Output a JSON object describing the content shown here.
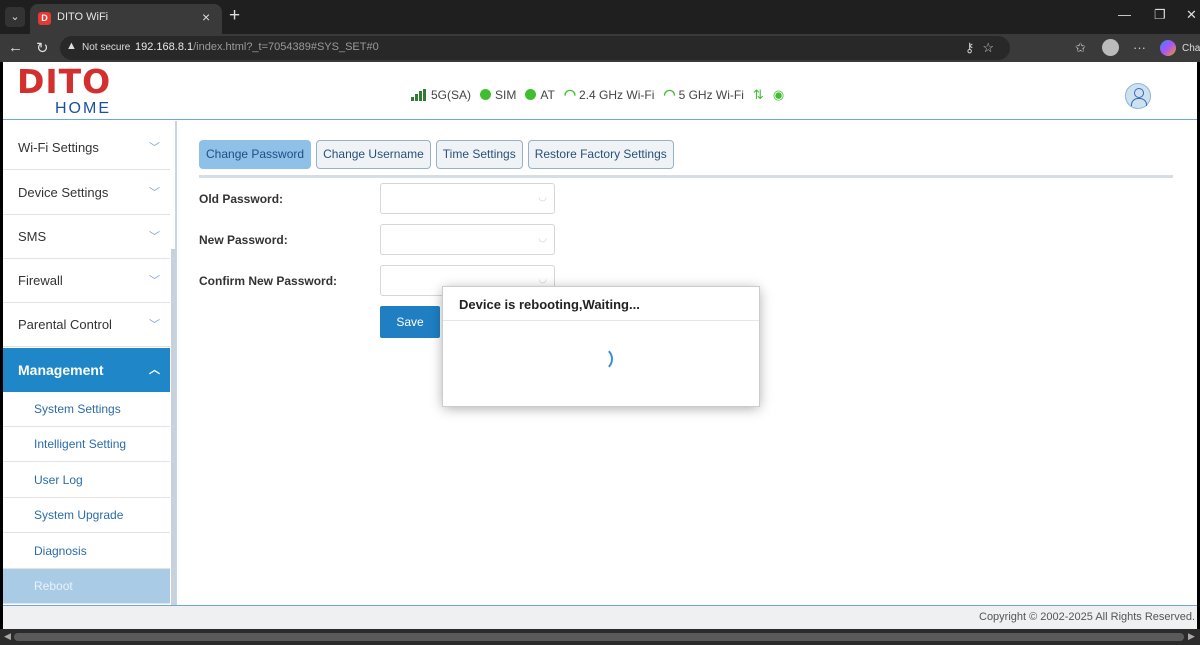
{
  "browser": {
    "tab_title": "DITO WiFi",
    "tab_icon": "D",
    "not_secure": "Not secure",
    "url_host": "192.168.8.1",
    "url_path": "/index.html?_t=7054389#SYS_SET#0",
    "copilot_label": "Cha"
  },
  "header": {
    "logo_top": "DITO",
    "logo_bottom": "HOME",
    "status": {
      "network": "5G(SA)",
      "sim": "SIM",
      "at": "AT",
      "wifi24": "2.4 GHz Wi-Fi",
      "wifi5": "5 GHz Wi-Fi"
    },
    "colors": {
      "status_green": "#3fbf2f",
      "brand_red": "#d32f2f",
      "brand_blue": "#1e4fa0"
    }
  },
  "sidebar": {
    "items": [
      {
        "label": "Wi-Fi Settings"
      },
      {
        "label": "Device Settings"
      },
      {
        "label": "SMS"
      },
      {
        "label": "Firewall"
      },
      {
        "label": "Parental Control"
      },
      {
        "label": "Management"
      }
    ],
    "subitems": [
      {
        "label": "System Settings"
      },
      {
        "label": "Intelligent Setting"
      },
      {
        "label": "User Log"
      },
      {
        "label": "System Upgrade"
      },
      {
        "label": "Diagnosis"
      },
      {
        "label": "Reboot"
      }
    ]
  },
  "main": {
    "tabs": [
      {
        "label": "Change Password"
      },
      {
        "label": "Change Username"
      },
      {
        "label": "Time Settings"
      },
      {
        "label": "Restore Factory Settings"
      }
    ],
    "fields": [
      {
        "label": "Old Password:",
        "value": ""
      },
      {
        "label": "New Password:",
        "value": ""
      },
      {
        "label": "Confirm New Password:",
        "value": ""
      }
    ],
    "save_label": "Save"
  },
  "modal": {
    "title": "Device is rebooting,Waiting..."
  },
  "footer": {
    "copyright": "Copyright © 2002-2025 All Rights Reserved."
  }
}
